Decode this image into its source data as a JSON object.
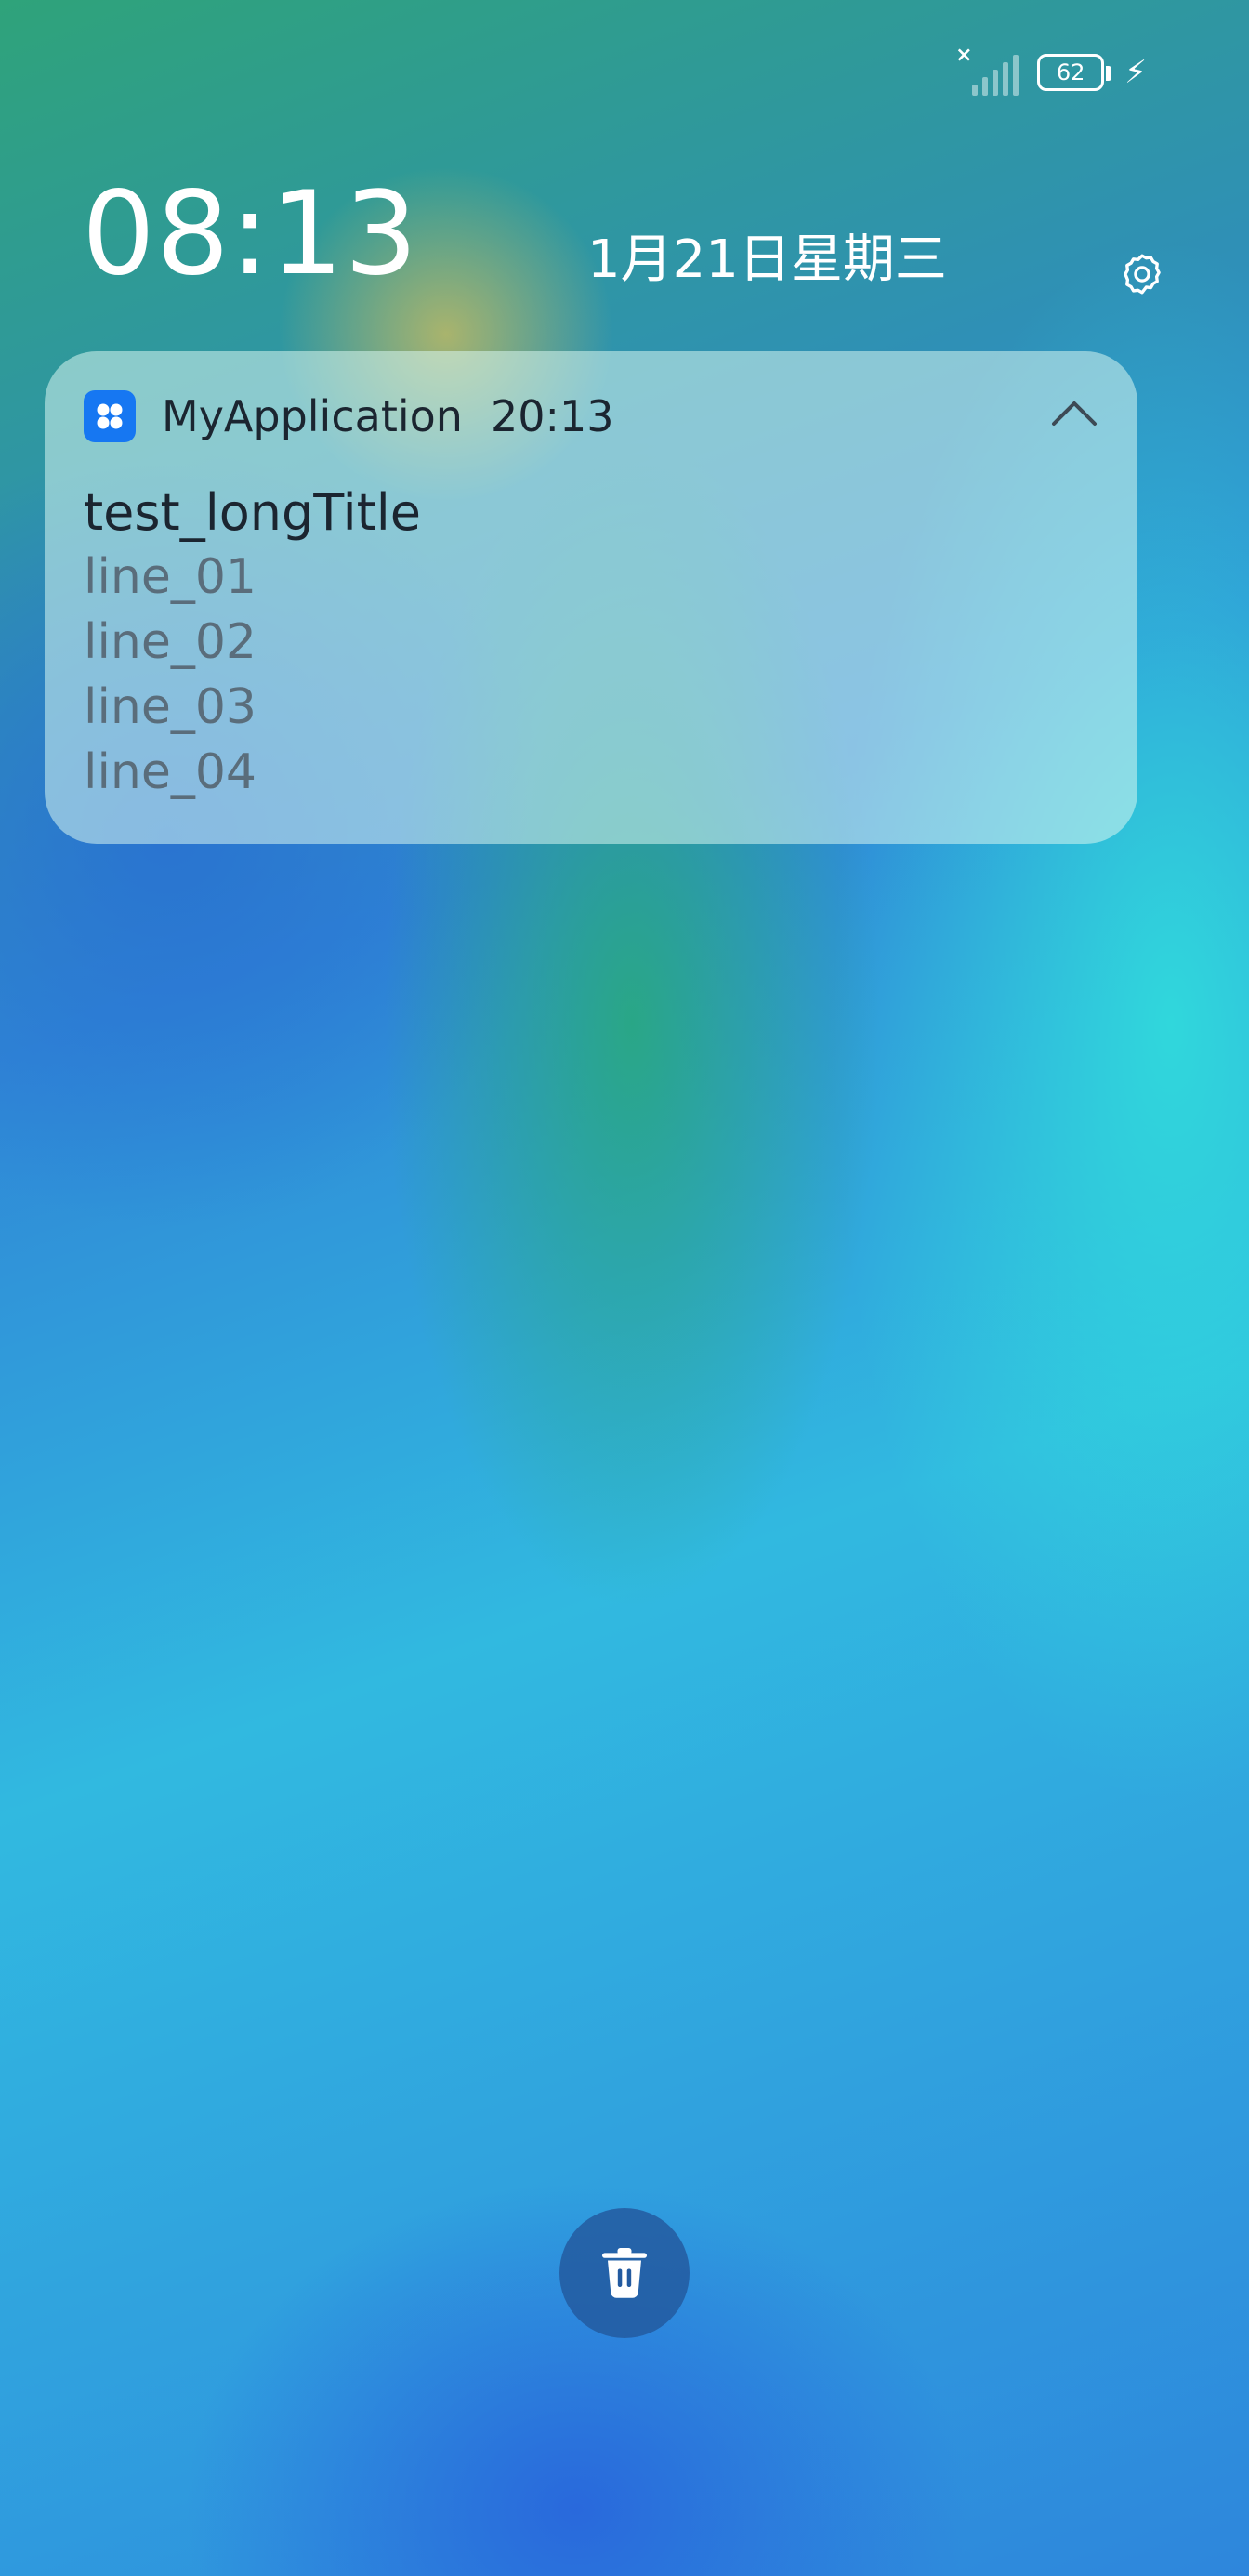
{
  "status_bar": {
    "signal_x": "×",
    "battery_level": "62",
    "charging_icon": "bolt-icon"
  },
  "lock_screen": {
    "time": "08:13",
    "date": "1月21日星期三",
    "settings_icon": "gear-icon"
  },
  "notification": {
    "app_icon": "app-grid-icon",
    "app_name": "MyApplication",
    "time": "20:13",
    "title": "test_longTitle",
    "lines": [
      "line_01",
      "line_02",
      "line_03",
      "line_04"
    ],
    "collapse_icon": "chevron-up-icon"
  },
  "actions": {
    "clear_icon": "trash-icon"
  },
  "colors": {
    "app_icon_bg": "#1677f2",
    "text_primary": "#1b2530",
    "text_secondary": "#5a6d7b"
  }
}
